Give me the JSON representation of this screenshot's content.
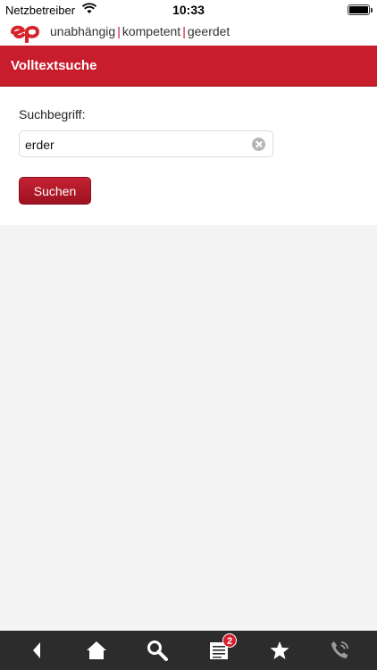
{
  "status_bar": {
    "carrier": "Netzbetreiber",
    "time": "10:33"
  },
  "brand": {
    "logo_text": "ep",
    "tagline": [
      "unabhängig",
      "kompetent",
      "geerdet"
    ],
    "separator": "|"
  },
  "page": {
    "title": "Volltextsuche"
  },
  "search": {
    "label": "Suchbegriff:",
    "value": "erder",
    "submit_label": "Suchen"
  },
  "toolbar": {
    "items": [
      {
        "icon": "back-icon"
      },
      {
        "icon": "home-icon"
      },
      {
        "icon": "search-icon"
      },
      {
        "icon": "list-icon",
        "badge": "2"
      },
      {
        "icon": "star-icon"
      },
      {
        "icon": "phone-icon"
      }
    ]
  },
  "colors": {
    "brand_red": "#c81d2d",
    "button_red": "#b01a28",
    "toolbar_bg": "#2c2c2c",
    "content_bg": "#f4f4f4"
  }
}
